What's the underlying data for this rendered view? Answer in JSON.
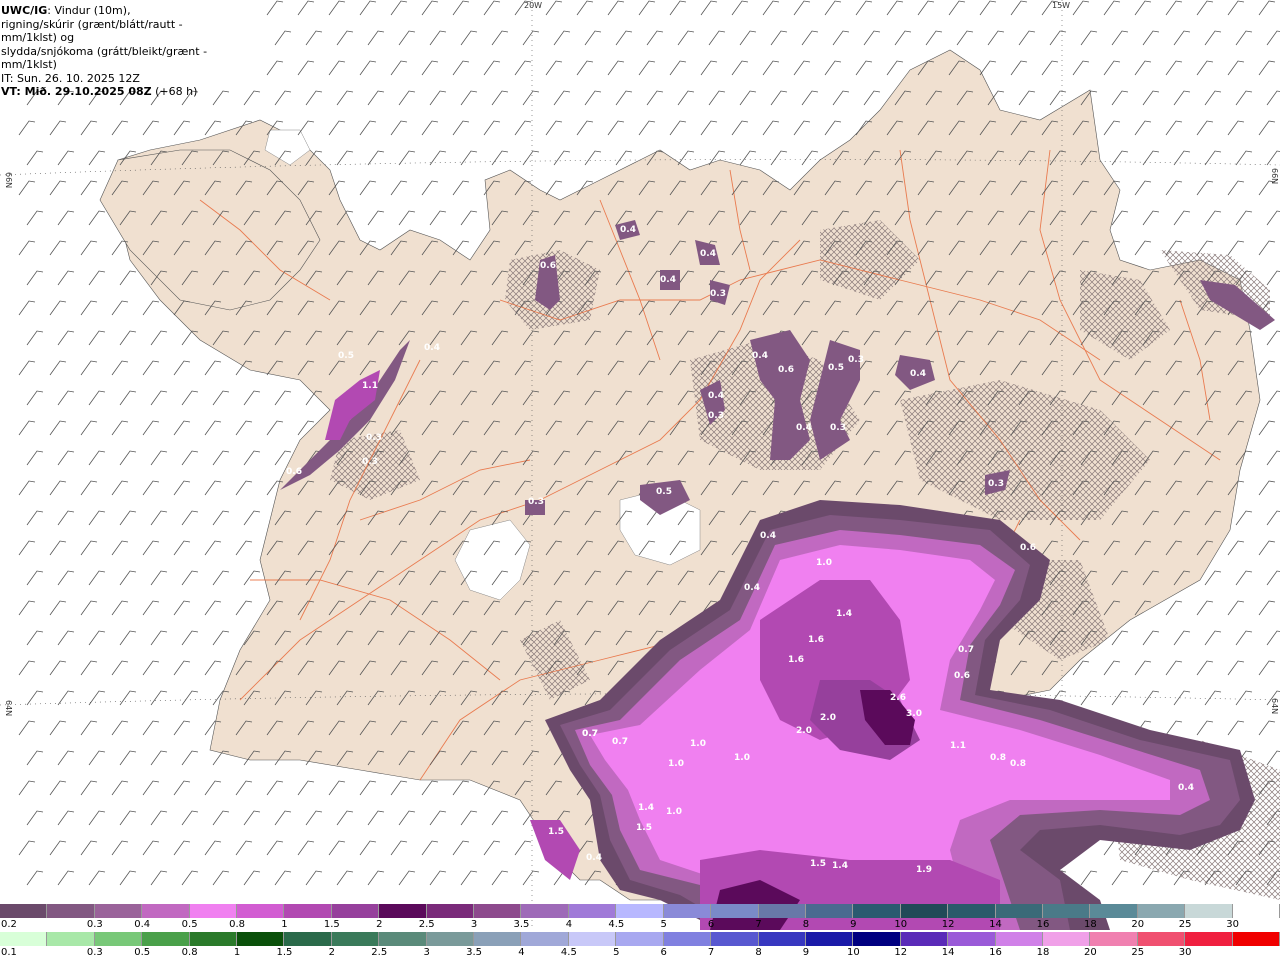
{
  "header": {
    "code": "UWC/IG",
    "line1_rest": ": Vindur (10m),",
    "line2": "rigning/skúrir (grænt/blátt/rautt - mm/1klst) og",
    "line3": "slydda/snjókoma (grátt/bleikt/grænt - mm/1klst)",
    "it": "IT: Sun. 26. 10. 2025 12Z",
    "vt_label": "VT: Mið. 29.10.2025 08Z",
    "vt_offset": "(+68 h)"
  },
  "grid_labels": {
    "lon_20w": "20W",
    "lon_15w": "15W",
    "lat_66n_left": "66N",
    "lat_66n_right": "66N",
    "lat_64n_left": "64N",
    "lat_64n_right": "64N"
  },
  "precip_labels": [
    "0.4",
    "0.6",
    "0.4",
    "0.3",
    "0.4",
    "0.4",
    "0.4",
    "0.6",
    "0.5",
    "0.3",
    "0.4",
    "0.5",
    "0.4",
    "0.3",
    "0.6",
    "1.1",
    "0.3",
    "0.3",
    "0.6",
    "0.3",
    "0.5",
    "0.3",
    "0.4",
    "0.3",
    "0.6",
    "0.4",
    "1.0",
    "0.4",
    "0.7",
    "1.4",
    "1.6",
    "1.6",
    "0.7",
    "0.6",
    "2.6",
    "3.0",
    "2.0",
    "2.0",
    "0.7",
    "0.7",
    "1.0",
    "1.0",
    "1.0",
    "1.1",
    "0.8",
    "0.8",
    "0.4",
    "1.4",
    "1.0",
    "1.5",
    "1.5",
    "0.4",
    "1.5",
    "1.4",
    "1.9"
  ],
  "legend_snow": {
    "colors": [
      "#6b4a6b",
      "#825882",
      "#9a639a",
      "#c169c1",
      "#f080f0",
      "#d25dd2",
      "#b249b2",
      "#96409c",
      "#5b0a5b",
      "#7a2a7a",
      "#8d4a8d",
      "#9e6ab8",
      "#a07ad8",
      "#b8b8ff",
      "#8a8ad8",
      "#7a8ac8",
      "#6878a8",
      "#4a6a90",
      "#2a5a70",
      "#204a58",
      "#2a5a6a",
      "#3a6a78",
      "#4a7a88",
      "#5a8a98",
      "#8aa8b0",
      "#c8d8d8",
      "#ffffff"
    ],
    "ticks": [
      "0.2",
      "0.3",
      "0.4",
      "0.5",
      "0.8",
      "1",
      "1.5",
      "2",
      "2.5",
      "3",
      "3.5",
      "4",
      "4.5",
      "5",
      "6",
      "7",
      "8",
      "9",
      "10",
      "12",
      "14",
      "16",
      "18",
      "20",
      "25",
      "30"
    ]
  },
  "legend_rain": {
    "colors": [
      "#d8ffd8",
      "#a8e8a8",
      "#78c878",
      "#4aa04a",
      "#2a7a2a",
      "#0a500a",
      "#2a6a4a",
      "#3a7a5a",
      "#5a8a7a",
      "#7a9a9a",
      "#8aa0b8",
      "#a0a8d8",
      "#c8c8f8",
      "#a8a8f0",
      "#8080e0",
      "#5858d0",
      "#3838c0",
      "#1a1aa8",
      "#000080",
      "#5a2ab8",
      "#9a5ad8",
      "#d080e8",
      "#f0a0e8",
      "#f080b0",
      "#f05070",
      "#f02040",
      "#f00000"
    ],
    "ticks": [
      "0.1",
      "0.3",
      "0.5",
      "0.8",
      "1",
      "1.5",
      "2",
      "2.5",
      "3",
      "3.5",
      "4",
      "4.5",
      "5",
      "6",
      "7",
      "8",
      "9",
      "10",
      "12",
      "14",
      "16",
      "18",
      "20",
      "25",
      "30"
    ]
  },
  "colors": {
    "land": "#f0e0d0",
    "sea": "#ffffff",
    "roads": "#e86a3a",
    "glacier": "#ffffff"
  }
}
